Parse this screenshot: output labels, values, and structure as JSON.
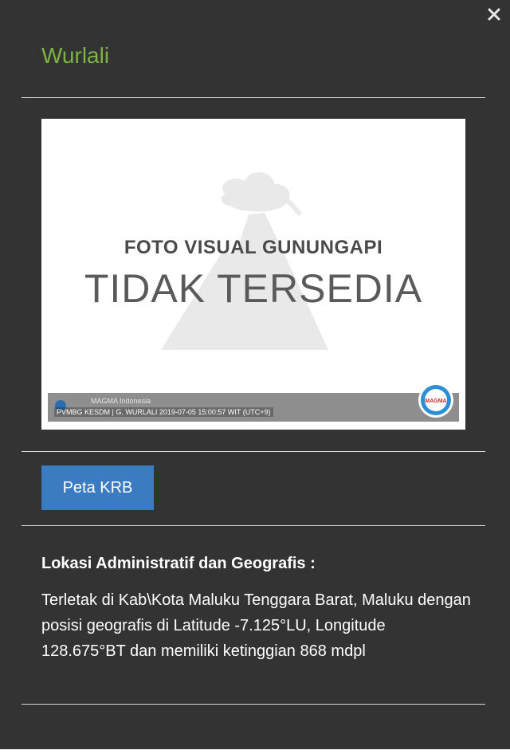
{
  "popup": {
    "title": "Wurlali",
    "close_glyph": "✕",
    "colors": {
      "title": "#7cb342",
      "background": "#333333",
      "button": "#3a7bc1"
    }
  },
  "photo": {
    "caption_line1": "FOTO VISUAL GUNUNGAPI",
    "caption_line2": "TIDAK TERSEDIA",
    "watermark_brand": "MAGMA Indonesia",
    "watermark_text": "PVMBG KESDM | G. WURLALI 2019-07-05 15:00:57 WIT (UTC+9)",
    "logo_text": "MAGMA"
  },
  "actions": {
    "map_button_label": "Peta KRB"
  },
  "location": {
    "heading": "Lokasi Administratif dan Geografis :",
    "description": "Terletak di Kab\\Kota Maluku Tenggara Barat, Maluku dengan posisi geografis di Latitude -7.125°LU, Longitude 128.675°BT dan memiliki ketinggian 868 mdpl"
  }
}
